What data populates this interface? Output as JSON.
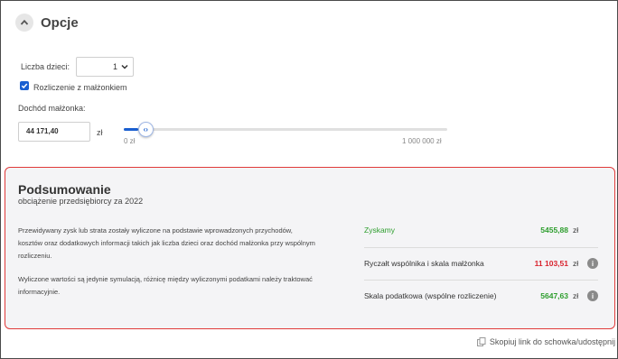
{
  "options": {
    "title": "Opcje",
    "children_label": "Liczba dzieci:",
    "children_value": "1",
    "spouse_checkbox_label": "Rozliczenie z małżonkiem",
    "spouse_income_label": "Dochód małżonka:",
    "spouse_income_value": "44 171,40",
    "spouse_income_unit": "zł",
    "slider_min_label": "0 zł",
    "slider_max_label": "1 000 000 zł",
    "slider_fraction": 0.0442
  },
  "summary": {
    "title": "Podsumowanie",
    "subtitle": "obciążenie przedsiębiorcy za 2022",
    "paragraph1": "Przewidywany zysk lub strata zostały wyliczone na podstawie wprowadzonych przychodów, kosztów oraz dodatkowych informacji takich jak liczba dzieci oraz dochód małżonka przy wspólnym rozliczeniu.",
    "paragraph2": "Wyliczone wartości są jedynie symulacją, różnicę między wyliczonymi podatkami należy traktować informacyjnie.",
    "rows": [
      {
        "label": "Zyskamy",
        "value": "5455,88",
        "unit": "zł",
        "label_color": "#2e9e2e",
        "value_color": "#2e9e2e"
      },
      {
        "label": "Ryczałt wspólnika i skala małżonka",
        "value": "11 103,51",
        "unit": "zł",
        "label_color": "#333333",
        "value_color": "#d9232e"
      },
      {
        "label": "Skala podatkowa (wspólne rozliczenie)",
        "value": "5647,63",
        "unit": "zł",
        "label_color": "#333333",
        "value_color": "#2e9e2e"
      }
    ]
  },
  "footer": {
    "copy_link_label": "Skopiuj link do schowka/udostępnij"
  },
  "colors": {
    "accent": "#1a5fd0",
    "highlight_border": "#e03a3a",
    "positive": "#2e9e2e",
    "negative": "#d9232e"
  }
}
